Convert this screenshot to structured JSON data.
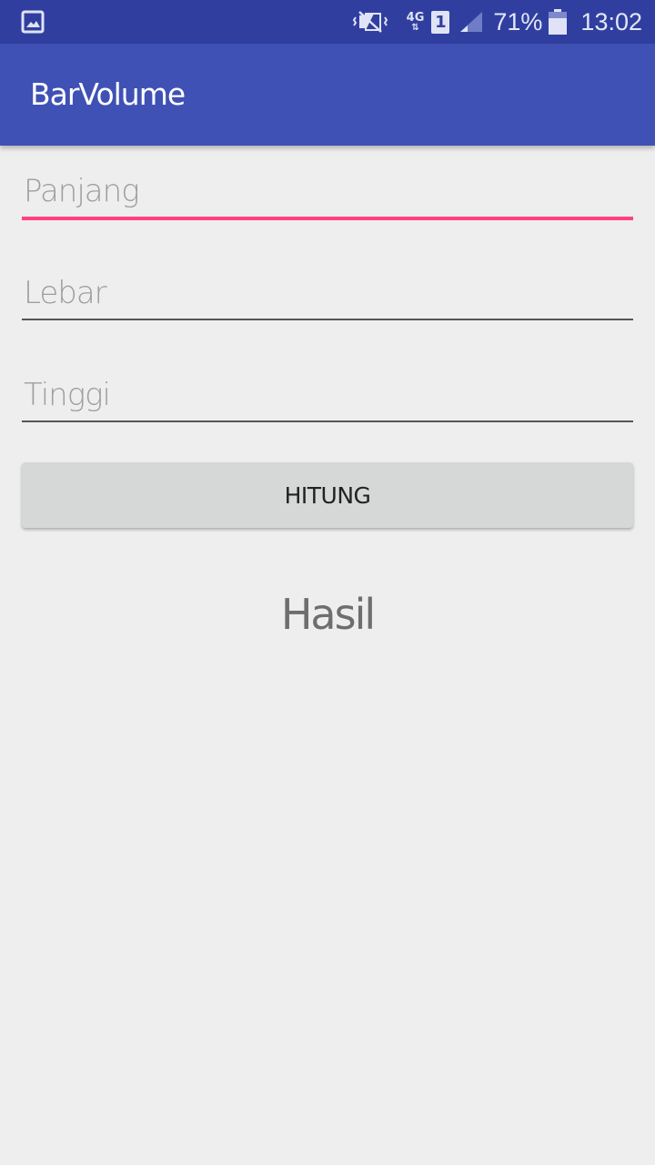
{
  "status_bar": {
    "left_icon": "gallery-icon",
    "icons": [
      "vibrate-icon",
      "network-4g-icon",
      "sim-1-icon",
      "signal-icon",
      "battery-icon"
    ],
    "network": "4G",
    "sim": "1",
    "battery": "71%",
    "time": "13:02"
  },
  "app_bar": {
    "title": "BarVolume"
  },
  "form": {
    "panjang_placeholder": "Panjang",
    "lebar_placeholder": "Lebar",
    "tinggi_placeholder": "Tinggi",
    "hitung_label": "HITUNG"
  },
  "result": {
    "text": "Hasil"
  },
  "colors": {
    "status_bar": "#303f9f",
    "app_bar": "#3f51b5",
    "accent": "#ff4081",
    "background": "#eeeeee"
  }
}
